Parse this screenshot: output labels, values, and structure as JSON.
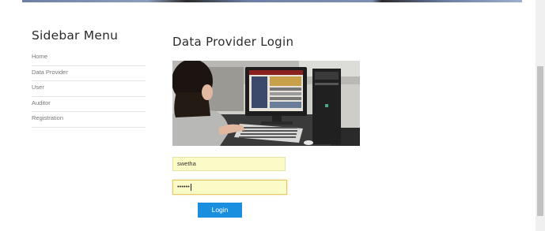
{
  "sidebar": {
    "title": "Sidebar Menu",
    "items": [
      {
        "label": "Home"
      },
      {
        "label": "Data Provider"
      },
      {
        "label": "User"
      },
      {
        "label": "Auditor"
      },
      {
        "label": "Registration"
      }
    ]
  },
  "main": {
    "title": "Data Provider Login",
    "form": {
      "username_value": "swetha",
      "password_masked": "••••••",
      "login_label": "Login"
    }
  },
  "colors": {
    "accent_button": "#1a8fe0",
    "input_background": "#fbfbc8",
    "focus_border": "#e8c565"
  }
}
